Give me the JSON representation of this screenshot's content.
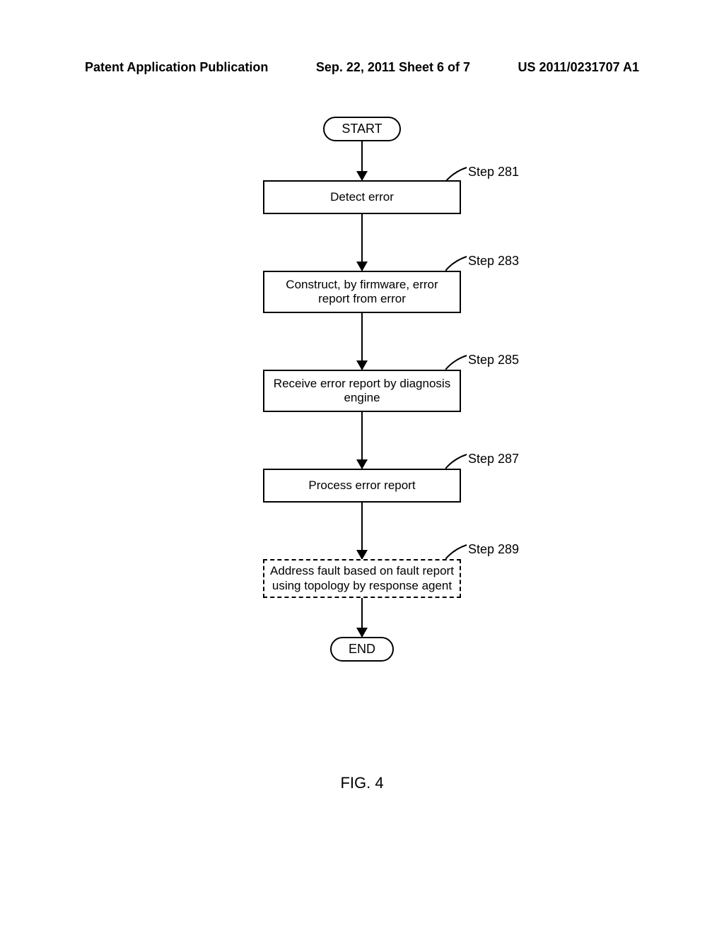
{
  "header": {
    "left": "Patent Application Publication",
    "middle": "Sep. 22, 2011  Sheet 6 of 7",
    "right": "US 2011/0231707 A1"
  },
  "flowchart": {
    "start": "START",
    "steps": [
      {
        "label": "Step 281",
        "text": "Detect error"
      },
      {
        "label": "Step 283",
        "text": "Construct, by firmware, error report from error"
      },
      {
        "label": "Step 285",
        "text": "Receive error report by diagnosis engine"
      },
      {
        "label": "Step 287",
        "text": "Process error report"
      },
      {
        "label": "Step 289",
        "text": "Address fault based on fault report using topology by response agent"
      }
    ],
    "end": "END"
  },
  "figure_label": "FIG. 4"
}
